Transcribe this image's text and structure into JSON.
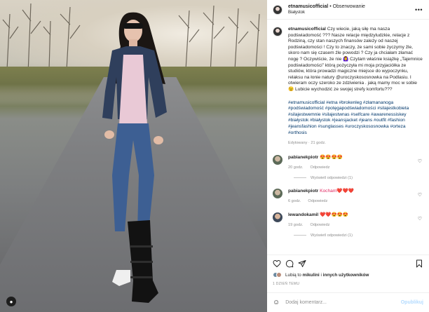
{
  "post": {
    "username": "etnamusicofficial",
    "follow_label": "Obserwowanie",
    "location": "Białystok",
    "caption": "Czy wiecie, jaką siłę ma nasza podświadomość ??? Nasze relacje międzyludzkie, relacje z Rodziną, czy stan naszych finansów zależy od naszej podświadomości ! Czy to znaczy, że sami sobie życzymy źle, skoro nam się czasem źle powodzi ? Czy ja chciałam złamać nogę ? Oczywiście, że nie 🙆‍♀️ Czytam właśnie książkę „Tajemnice podświadomości” którą pożyczyła mi moja przyjaciółka ze studiów, która prowadzi magiczne miejsce do wypoczynku, relaksu na łonie natury @uroczyskososnowka na Podlasiu. I otwieram oczy szeroko ze zdziwienia . jaką mamy moc w sobie 😉 Lubicie wychodzić ze swojej strefy komfortu???",
    "hashtags": "#etnamusicofficial #etna #brokenleg #złamananoga #podświadomość #potęgapodświadomości #silajestkobieta #silajestwemnie #silajestwnas #selfcare #awarenessiskey #białystok #białystok #jeansjacket #jeans #outfit #fashion #jeansfashion #sunglasses #uroczyskososnowka #orteza #orthosis",
    "edited_meta": "Edytowany · 21 godz."
  },
  "comments": [
    {
      "user": "pabianekpiotr",
      "text": "😍😍😍😍",
      "time": "20 godz.",
      "reply": "Odpowiedz",
      "view_replies": "Wyświetl odpowiedzi (1)"
    },
    {
      "user": "pabianekpiotr",
      "text": "Kocham❤️❤️❤️",
      "time": "6 godz.",
      "reply": "Odpowiedz",
      "view_replies": ""
    },
    {
      "user": "lewandokamil",
      "text": "❤️❤️😍😍😍",
      "time": "19 godz.",
      "reply": "Odpowiedz",
      "view_replies": "Wyświetl odpowiedzi (1)"
    }
  ],
  "likes": {
    "prefix": "Lubią to",
    "user": "mikulini",
    "suffix": "i",
    "others": "innych użytkowników"
  },
  "age": "1 DZIEŃ TEMU",
  "add_comment": {
    "placeholder": "Dodaj komentarz...",
    "publish": "Opublikuj"
  },
  "icons": [
    "heart-icon",
    "comment-icon",
    "share-icon",
    "bookmark-icon",
    "more-icon",
    "smile-icon"
  ]
}
